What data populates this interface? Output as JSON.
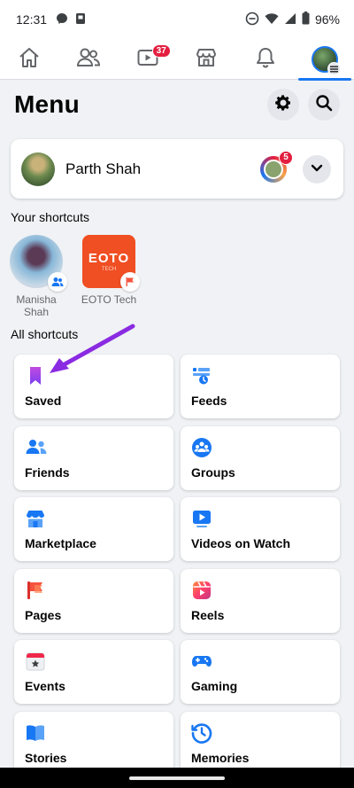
{
  "status_bar": {
    "time": "12:31",
    "battery": "96%"
  },
  "tabs": [
    {
      "name": "home",
      "icon": "home-icon"
    },
    {
      "name": "friends",
      "icon": "friends-icon"
    },
    {
      "name": "watch",
      "icon": "video-icon",
      "badge": "37"
    },
    {
      "name": "marketplace",
      "icon": "marketplace-icon"
    },
    {
      "name": "notifications",
      "icon": "bell-icon"
    },
    {
      "name": "menu",
      "icon": "profile-menu-icon",
      "active": true
    }
  ],
  "header": {
    "title": "Menu"
  },
  "profile": {
    "name": "Parth Shah",
    "story_badge": "5"
  },
  "your_shortcuts": {
    "label": "Your shortcuts",
    "items": [
      {
        "name": "Manisha\nShah",
        "line1": "Manisha",
        "line2": "Shah",
        "type": "friend"
      },
      {
        "name": "EOTO Tech",
        "logo_text": "EOTO",
        "logo_sub": "TECH",
        "type": "page"
      }
    ]
  },
  "all_shortcuts": {
    "label": "All shortcuts",
    "tiles": [
      {
        "label": "Saved",
        "icon": "bookmark-icon",
        "color": "#a033ff"
      },
      {
        "label": "Feeds",
        "icon": "feeds-icon",
        "color": "#1877f2"
      },
      {
        "label": "Friends",
        "icon": "friends-icon",
        "color": "#1877f2"
      },
      {
        "label": "Groups",
        "icon": "groups-icon",
        "color": "#1877f2"
      },
      {
        "label": "Marketplace",
        "icon": "marketplace-icon",
        "color": "#1877f2"
      },
      {
        "label": "Videos on Watch",
        "icon": "watch-icon",
        "color": "#1877f2"
      },
      {
        "label": "Pages",
        "icon": "flag-icon",
        "color": "#f5533d"
      },
      {
        "label": "Reels",
        "icon": "reels-icon",
        "color": "#ff4f6e"
      },
      {
        "label": "Events",
        "icon": "calendar-icon",
        "color": "#f02849"
      },
      {
        "label": "Gaming",
        "icon": "gamepad-icon",
        "color": "#1877f2"
      },
      {
        "label": "Stories",
        "icon": "book-icon",
        "color": "#1877f2"
      },
      {
        "label": "Memories",
        "icon": "clock-icon",
        "color": "#1877f2"
      }
    ]
  },
  "colors": {
    "accent": "#1877f2",
    "badge": "#e41e3f",
    "background": "#f0f2f5",
    "arrow": "#8a2be2"
  }
}
